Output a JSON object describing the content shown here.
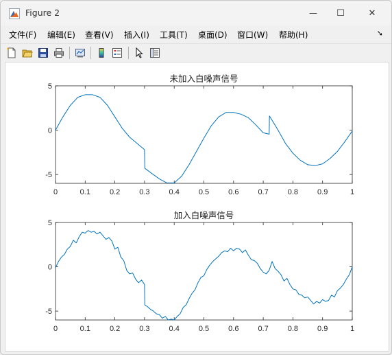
{
  "window": {
    "title": "Figure 2",
    "minimize_glyph": "—",
    "maximize_glyph": "☐",
    "close_glyph": "✕"
  },
  "menu": {
    "items": [
      "文件(F)",
      "编辑(E)",
      "查看(V)",
      "插入(I)",
      "工具(T)",
      "桌面(D)",
      "窗口(W)",
      "帮助(H)"
    ],
    "overflow_glyph": "➘"
  },
  "toolbar": {
    "buttons": [
      "new-figure-icon",
      "open-file-icon",
      "save-icon",
      "print-icon",
      "link-plot-icon",
      "colorbar-icon",
      "legend-icon",
      "pointer-icon",
      "property-inspector-icon"
    ]
  },
  "colors": {
    "line": "#0072bd",
    "axes_box": "#262626"
  },
  "chart_data": [
    {
      "type": "line",
      "title": "未加入白噪声信号",
      "xlabel": "",
      "ylabel": "",
      "xlim": [
        0,
        1
      ],
      "ylim": [
        -6,
        5
      ],
      "xticks": [
        "0",
        "0.1",
        "0.2",
        "0.3",
        "0.4",
        "0.5",
        "0.6",
        "0.7",
        "0.8",
        "0.9",
        "1"
      ],
      "yticks": [
        "5",
        "0",
        "-5"
      ],
      "grid": false,
      "series": [
        {
          "x": [
            0,
            0.025,
            0.05,
            0.075,
            0.1,
            0.125,
            0.15,
            0.175,
            0.2,
            0.225,
            0.25,
            0.275,
            0.3,
            0.301,
            0.325,
            0.35,
            0.375,
            0.4,
            0.425,
            0.45,
            0.475,
            0.5,
            0.525,
            0.55,
            0.575,
            0.6,
            0.625,
            0.65,
            0.675,
            0.7,
            0.72,
            0.721,
            0.75,
            0.775,
            0.8,
            0.825,
            0.85,
            0.875,
            0.9,
            0.925,
            0.95,
            0.975,
            1.0
          ],
          "y": [
            0,
            1.5,
            2.8,
            3.7,
            4.0,
            4.0,
            3.7,
            2.8,
            1.5,
            0.2,
            -0.8,
            -1.5,
            -2.2,
            -4.3,
            -4.9,
            -5.5,
            -5.95,
            -5.95,
            -5.2,
            -3.9,
            -2.4,
            -0.9,
            0.5,
            1.5,
            2.0,
            2.0,
            1.8,
            1.4,
            0.6,
            -0.3,
            -0.45,
            1.6,
            0.0,
            -1.5,
            -2.6,
            -3.4,
            -3.9,
            -4.0,
            -3.8,
            -3.2,
            -2.4,
            -1.3,
            -0.1
          ]
        }
      ]
    },
    {
      "type": "line",
      "title": "加入白噪声信号",
      "xlabel": "",
      "ylabel": "",
      "xlim": [
        0,
        1
      ],
      "ylim": [
        -6,
        5
      ],
      "xticks": [
        "0",
        "0.1",
        "0.2",
        "0.3",
        "0.4",
        "0.5",
        "0.6",
        "0.7",
        "0.8",
        "0.9",
        "1"
      ],
      "yticks": [
        "5",
        "0",
        "-5"
      ],
      "grid": false,
      "series": [
        {
          "x": [
            0,
            0.01,
            0.02,
            0.03,
            0.04,
            0.05,
            0.06,
            0.07,
            0.08,
            0.09,
            0.1,
            0.11,
            0.12,
            0.13,
            0.14,
            0.15,
            0.16,
            0.17,
            0.18,
            0.19,
            0.2,
            0.21,
            0.22,
            0.23,
            0.24,
            0.25,
            0.26,
            0.27,
            0.28,
            0.29,
            0.3,
            0.301,
            0.31,
            0.32,
            0.33,
            0.34,
            0.35,
            0.36,
            0.37,
            0.38,
            0.39,
            0.4,
            0.41,
            0.42,
            0.43,
            0.44,
            0.45,
            0.46,
            0.47,
            0.48,
            0.49,
            0.5,
            0.51,
            0.52,
            0.53,
            0.54,
            0.55,
            0.56,
            0.57,
            0.58,
            0.59,
            0.6,
            0.61,
            0.62,
            0.63,
            0.64,
            0.65,
            0.66,
            0.67,
            0.68,
            0.69,
            0.7,
            0.71,
            0.72,
            0.73,
            0.74,
            0.75,
            0.76,
            0.77,
            0.78,
            0.79,
            0.8,
            0.81,
            0.82,
            0.83,
            0.84,
            0.85,
            0.86,
            0.87,
            0.88,
            0.89,
            0.9,
            0.91,
            0.92,
            0.93,
            0.94,
            0.95,
            0.96,
            0.97,
            0.98,
            0.99,
            1.0
          ],
          "y": [
            -0.1,
            0.6,
            1.1,
            1.4,
            2.0,
            2.3,
            3.0,
            2.7,
            3.4,
            3.9,
            3.8,
            4.1,
            3.9,
            4.0,
            3.7,
            3.9,
            3.5,
            3.1,
            3.3,
            2.9,
            2.0,
            2.2,
            1.1,
            0.7,
            -0.4,
            -0.8,
            -0.7,
            -1.4,
            -1.8,
            -1.5,
            -2.0,
            -4.3,
            -4.5,
            -4.8,
            -5.0,
            -5.3,
            -5.4,
            -5.8,
            -5.6,
            -6.0,
            -5.9,
            -6.0,
            -5.6,
            -5.3,
            -4.6,
            -4.3,
            -3.6,
            -3.0,
            -2.6,
            -1.8,
            -1.2,
            -1.0,
            -0.3,
            0.2,
            0.6,
            0.9,
            1.2,
            1.6,
            1.8,
            1.7,
            2.1,
            1.8,
            2.1,
            2.0,
            1.6,
            1.9,
            1.3,
            0.8,
            0.7,
            0.4,
            -0.2,
            -0.6,
            -0.8,
            -0.4,
            0.6,
            -0.2,
            -0.5,
            -0.9,
            -1.6,
            -1.3,
            -2.0,
            -2.5,
            -2.6,
            -3.1,
            -3.2,
            -3.5,
            -3.4,
            -3.8,
            -4.2,
            -3.9,
            -4.1,
            -3.7,
            -3.9,
            -3.8,
            -3.2,
            -3.4,
            -2.7,
            -2.4,
            -2.0,
            -1.4,
            -0.9,
            0.0
          ]
        }
      ]
    }
  ]
}
